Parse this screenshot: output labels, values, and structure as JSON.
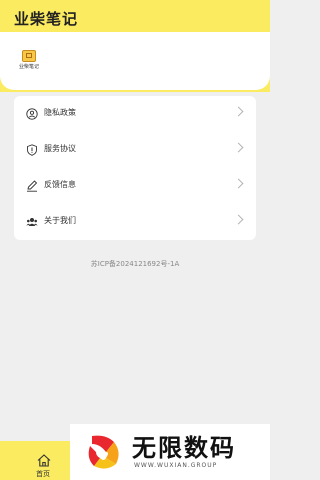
{
  "header": {
    "title": "业柴笔记"
  },
  "profile": {
    "logo_text": "业柴笔记"
  },
  "menu": [
    {
      "label": "隐私政策",
      "icon": "user-icon"
    },
    {
      "label": "服务协议",
      "icon": "shield-icon"
    },
    {
      "label": "反馈信息",
      "icon": "pen-icon"
    },
    {
      "label": "关于我们",
      "icon": "group-icon"
    }
  ],
  "footer": {
    "icp": "苏ICP备2024121692号-1A"
  },
  "tabbar": {
    "home_label": "首页"
  },
  "watermark": {
    "name": "无限数码",
    "url": "WWW.WUXIAN.GROUP"
  },
  "colors": {
    "accent": "#fbeb60"
  }
}
